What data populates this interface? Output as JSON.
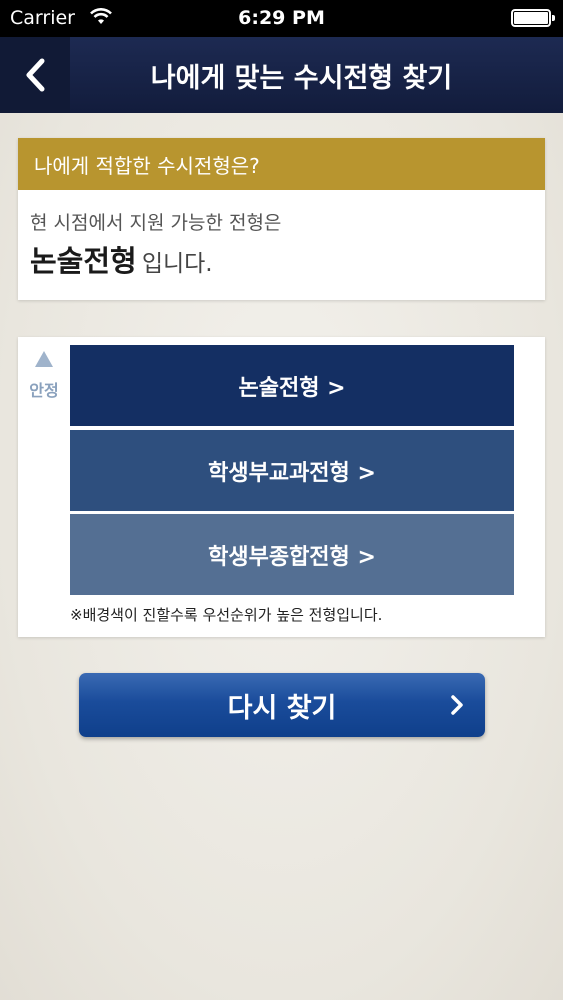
{
  "status_bar": {
    "carrier": "Carrier",
    "time": "6:29 PM"
  },
  "nav": {
    "title": "나에게 맞는 수시전형 찾기",
    "back_icon": "chevron-left-icon"
  },
  "result_card": {
    "header": "나에게 적합한 수시전형은?",
    "subtitle": "현 시점에서 지원 가능한 전형은",
    "result_type": "논술전형",
    "result_suffix": "입니다."
  },
  "options_card": {
    "stable_label": "안정",
    "options": [
      {
        "label": "논술전형 >",
        "color": "#142f63"
      },
      {
        "label": "학생부교과전형 >",
        "color": "#2e4f7e"
      },
      {
        "label": "학생부종합전형 >",
        "color": "#546f93"
      }
    ],
    "note": "※배경색이 진할수록 우선순위가 높은 전형입니다."
  },
  "retry_button": {
    "label": "다시 찾기",
    "color": "#1a4c9b"
  },
  "colors": {
    "accent_gold": "#b8952f",
    "nav_bg": "#1d2a52"
  }
}
